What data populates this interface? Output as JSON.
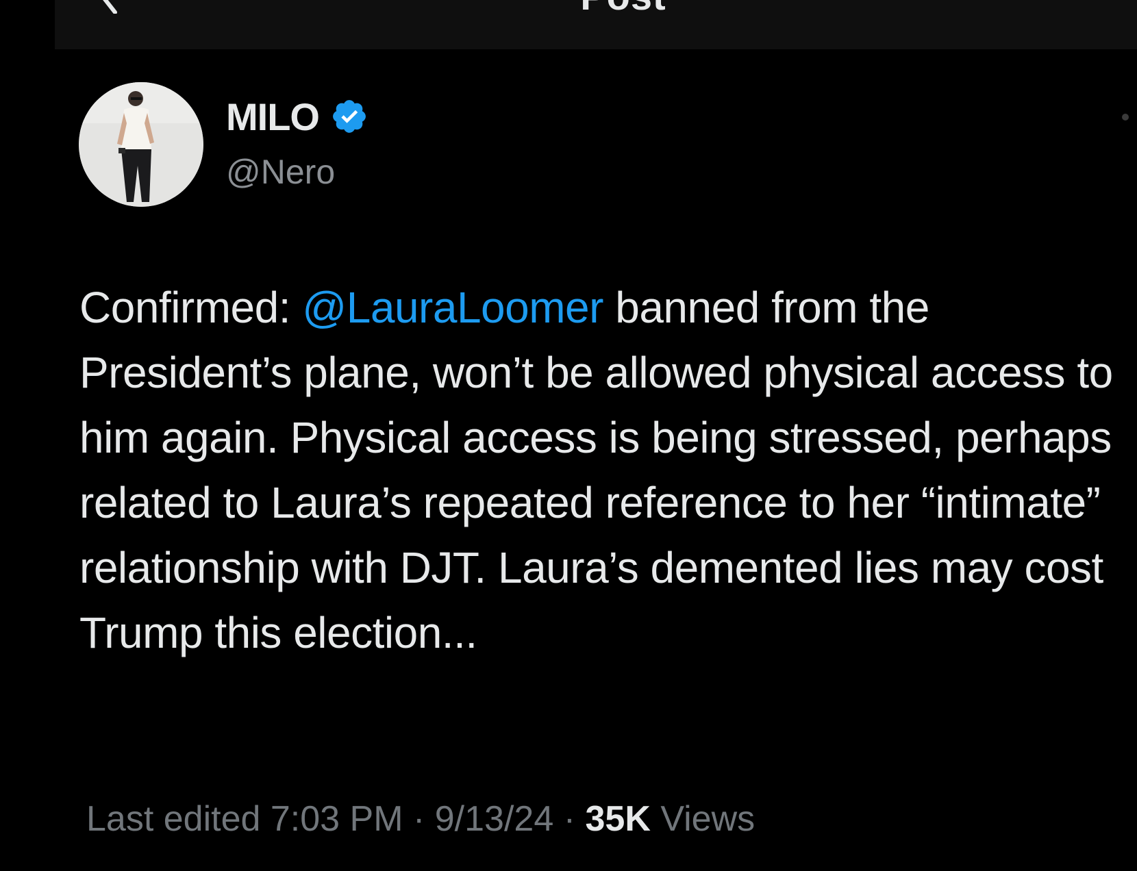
{
  "header": {
    "title": "Post",
    "back_icon": "chevron-left-icon"
  },
  "author": {
    "display_name": "MILO",
    "handle": "@Nero",
    "verified": true,
    "verified_color": "#1d9bf0"
  },
  "tweet": {
    "text_before_mention": "Confirmed: ",
    "mention": "@LauraLoomer",
    "text_after_mention": " banned from the President’s plane, won’t be allowed physical access to him again. Physical access is being stressed, perhaps related to Laura’s repeated reference to her “intimate” relationship with DJT. Laura’s demented lies may cost Trump this election...",
    "mention_color": "#1d9bf0"
  },
  "meta": {
    "edited_label": "Last edited",
    "time": "7:03 PM",
    "separator": "·",
    "date": "9/13/24",
    "views_count": "35K",
    "views_label": "Views"
  },
  "colors": {
    "background": "#000000",
    "text": "#e7e9ea",
    "muted": "#71767b",
    "accent": "#1d9bf0"
  }
}
